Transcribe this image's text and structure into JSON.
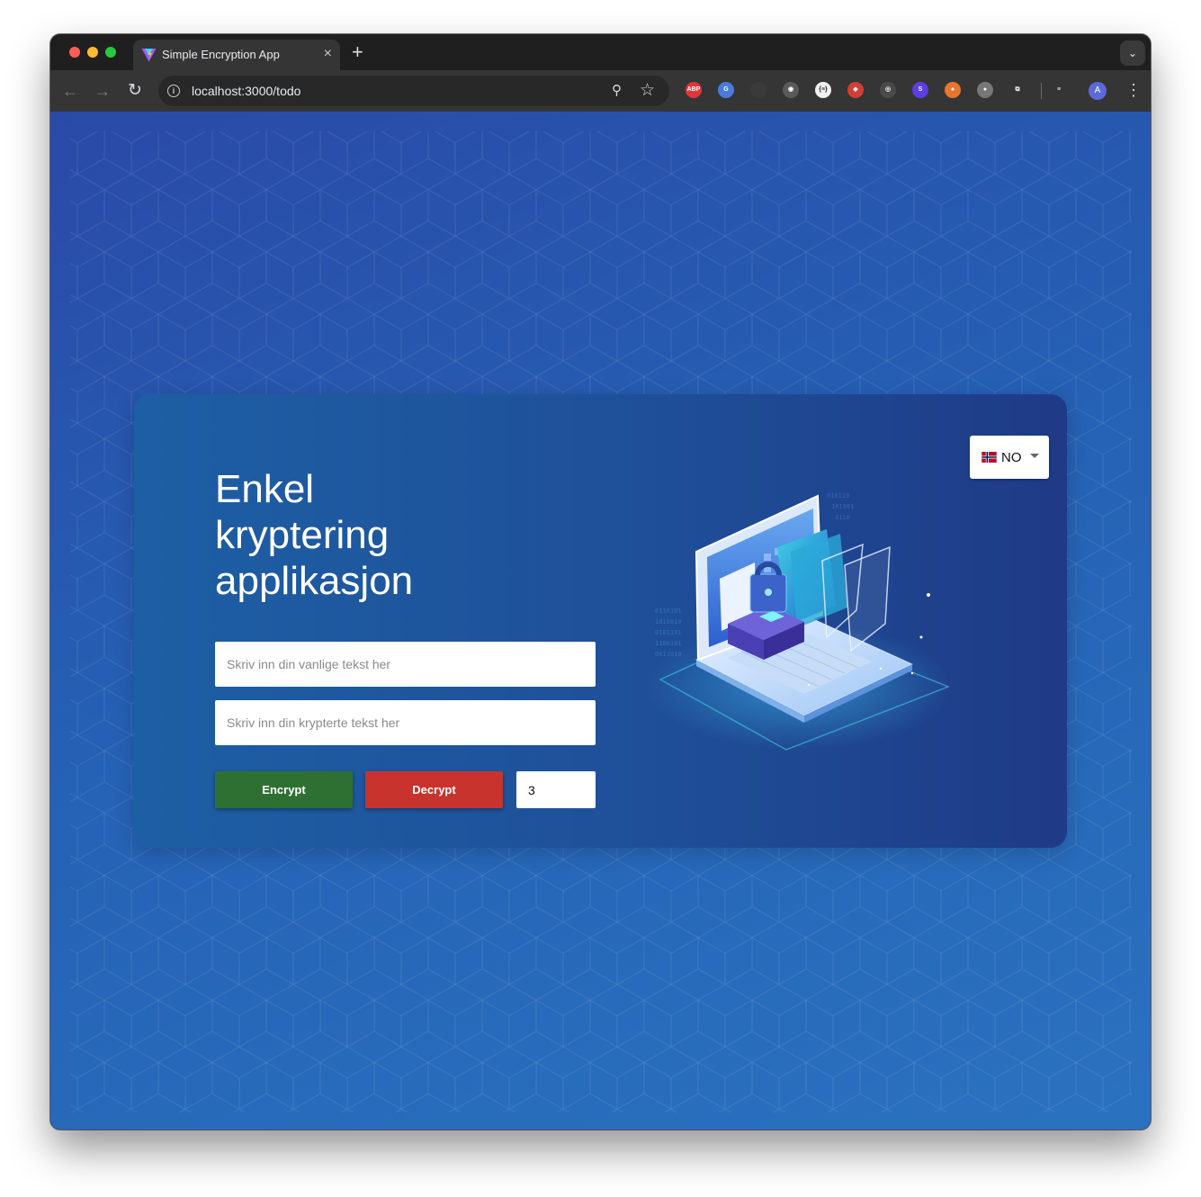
{
  "browser": {
    "tab_title": "Simple Encryption App",
    "tab_close_glyph": "×",
    "new_tab_glyph": "+",
    "tab_search_glyph": "⌄",
    "url": "localhost:3000/todo",
    "back_glyph": "←",
    "forward_glyph": "→",
    "reload_glyph": "↻",
    "info_glyph": "i",
    "zoom_glyph": "⚲",
    "star_glyph": "☆",
    "extensions": [
      {
        "name": "adblock-icon",
        "label": "ABP",
        "color": "#e2353a"
      },
      {
        "name": "translate-icon",
        "label": "G",
        "color": "#4a7bd8"
      },
      {
        "name": "puzzle-dark-icon",
        "label": "",
        "color": "#3a3a3a"
      },
      {
        "name": "camera-icon",
        "label": "◉",
        "color": "#5a5a5a"
      },
      {
        "name": "json-icon",
        "label": "{≡}",
        "color": "#f1f1f1"
      },
      {
        "name": "red-ext-icon",
        "label": "◈",
        "color": "#cf3f35"
      },
      {
        "name": "target-icon",
        "label": "◎",
        "color": "#4a4a4a"
      },
      {
        "name": "s-ext-icon",
        "label": "S",
        "color": "#5b3ee8"
      },
      {
        "name": "pill-icon",
        "label": "●",
        "color": "#e8752f"
      },
      {
        "name": "grey-pill-icon",
        "label": "●",
        "color": "#777777"
      },
      {
        "name": "extensions-puzzle-icon",
        "label": "⧉",
        "color": "#353535"
      },
      {
        "name": "media-queue-icon",
        "label": "≡",
        "color": "#353535"
      }
    ],
    "avatar_letter": "A",
    "menu_glyph": "⋮"
  },
  "app": {
    "language": {
      "code": "NO",
      "flag": "norway-flag"
    },
    "title": "Enkel kryptering applikasjon",
    "plaintext": {
      "placeholder": "Skriv inn din vanlige tekst her",
      "value": ""
    },
    "ciphertext": {
      "placeholder": "Skriv inn din krypterte tekst her",
      "value": ""
    },
    "encrypt_label": "Encrypt",
    "decrypt_label": "Decrypt",
    "shift_value": "3"
  },
  "colors": {
    "encrypt": "#2e7032",
    "decrypt": "#c8332d",
    "background": "#2560b4",
    "card": "#1f4f99"
  }
}
